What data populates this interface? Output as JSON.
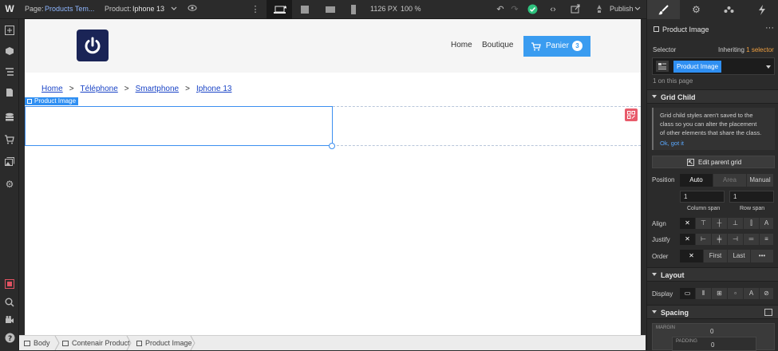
{
  "topbar": {
    "page_label": "Page:",
    "page_value": "Products Tem...",
    "product_label": "Product:",
    "product_value": "Iphone 13",
    "width_value": "1126 PX",
    "zoom_value": "100 %",
    "publish_label": "Publish"
  },
  "canvas": {
    "nav": [
      "Home",
      "Boutique"
    ],
    "cart_label": "Panier",
    "cart_count": "3",
    "breadcrumb": [
      "Home",
      "Téléphone",
      "Smartphone",
      "Iphone 13"
    ],
    "crumb_sep": ">",
    "selected_tag": "Product Image"
  },
  "bottombar": {
    "items": [
      "Body",
      "Contenair Product",
      "Product Image"
    ]
  },
  "panel": {
    "element_name": "Product Image",
    "selector_label": "Selector",
    "inheriting_prefix": "Inheriting",
    "inheriting_link": "1 selector",
    "selector_value": "Product Image",
    "on_page": "1 on this page",
    "grid_child_title": "Grid Child",
    "grid_child_note": [
      "Grid child styles aren't saved to the",
      "class so you can alter the placement",
      "of other elements that share the class."
    ],
    "ok_got_it": "Ok, got it",
    "edit_parent_grid": "Edit parent grid",
    "position_label": "Position",
    "position_options": [
      "Auto",
      "Area",
      "Manual"
    ],
    "column_span_value": "1",
    "row_span_value": "1",
    "column_span_label": "Column span",
    "row_span_label": "Row span",
    "align_label": "Align",
    "justify_label": "Justify",
    "order_label": "Order",
    "order_options": [
      "First",
      "Last",
      "•••"
    ],
    "layout_title": "Layout",
    "display_label": "Display",
    "spacing_title": "Spacing",
    "margin_label": "MARGIN",
    "margin_value": "0",
    "padding_label": "PADDING",
    "padding_value": "0"
  },
  "colors": {
    "accent": "#3a9cf0",
    "selection": "#2f8ff2",
    "success": "#2ec27e",
    "warning_link": "#f0a040"
  }
}
